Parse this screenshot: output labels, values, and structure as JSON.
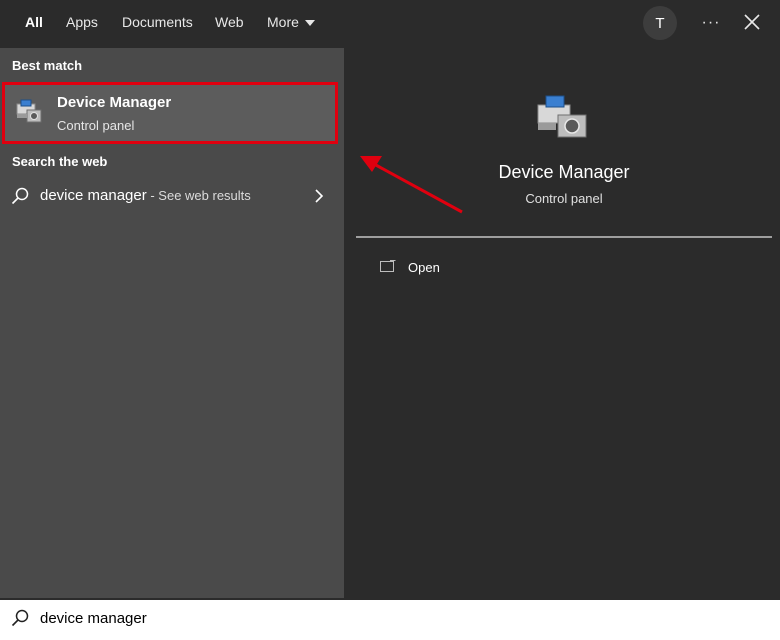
{
  "tabs": [
    {
      "label": "All"
    },
    {
      "label": "Apps"
    },
    {
      "label": "Documents"
    },
    {
      "label": "Web"
    },
    {
      "label": "More"
    }
  ],
  "header": {
    "avatar_initial": "T",
    "more_options": "···",
    "icons": [
      "chevron-down-icon",
      "more-options-icon",
      "close-icon"
    ]
  },
  "left": {
    "best_match_title": "Best match",
    "best_match": {
      "title": "Device Manager",
      "subtitle": "Control panel",
      "icon": "device-manager-icon"
    },
    "search_web_title": "Search the web",
    "web_result": {
      "query": "device manager",
      "suffix": " - See web results",
      "icon": "search-icon"
    }
  },
  "right": {
    "title": "Device Manager",
    "subtitle": "Control panel",
    "actions": [
      {
        "label": "Open",
        "icon": "open-window-icon"
      }
    ]
  },
  "search": {
    "value": "device manager",
    "icon": "search-icon"
  },
  "colors": {
    "highlight_border": "#e0000f",
    "left_panel": "#4a4a4a",
    "right_panel": "#2b2b2b",
    "annotation_arrow": "#e0000f"
  }
}
